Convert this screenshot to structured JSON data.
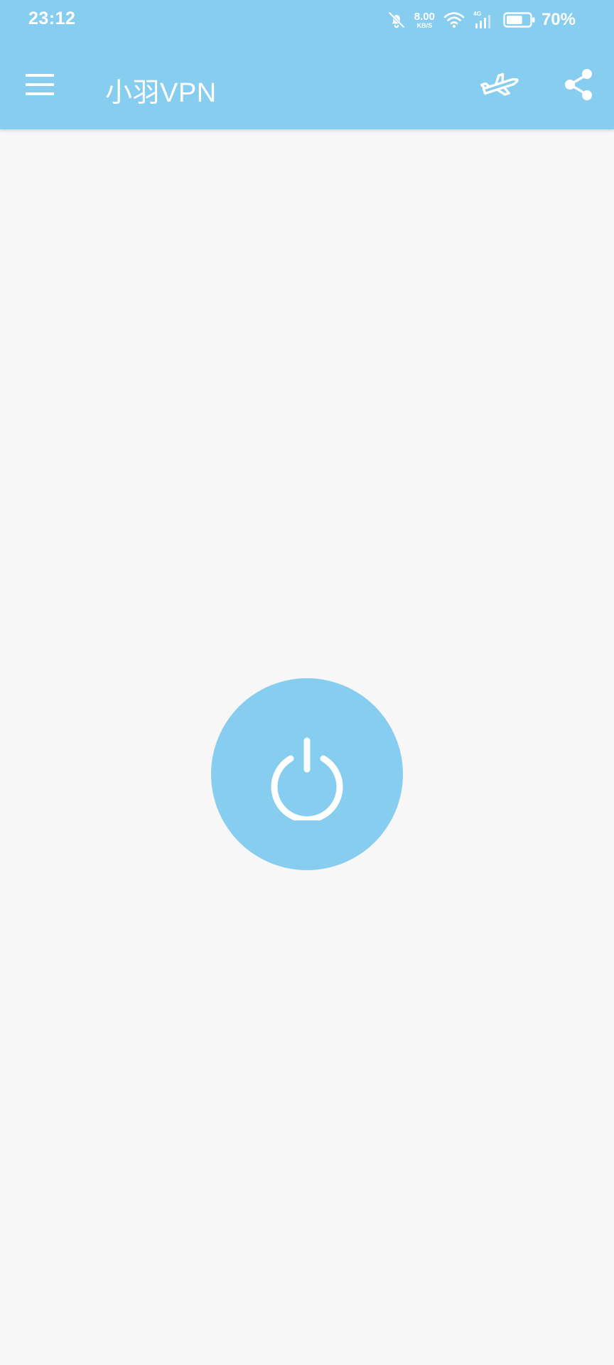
{
  "status_bar": {
    "time": "23:12",
    "net_speed_value": "8.00",
    "net_speed_unit": "KB/S",
    "network_type": "4G",
    "battery_percent": "70%",
    "battery_level": 0.7,
    "icons": [
      "bell-off-icon",
      "wifi-icon",
      "signal-icon",
      "battery-icon"
    ]
  },
  "toolbar": {
    "title": "小羽VPN",
    "icons": [
      "menu-icon",
      "plane-icon",
      "share-icon"
    ]
  },
  "main": {
    "power_icon": "power-icon"
  },
  "colors": {
    "primary": "#87cdef",
    "background": "#f7f7f7",
    "foreground": "#ffffff"
  }
}
